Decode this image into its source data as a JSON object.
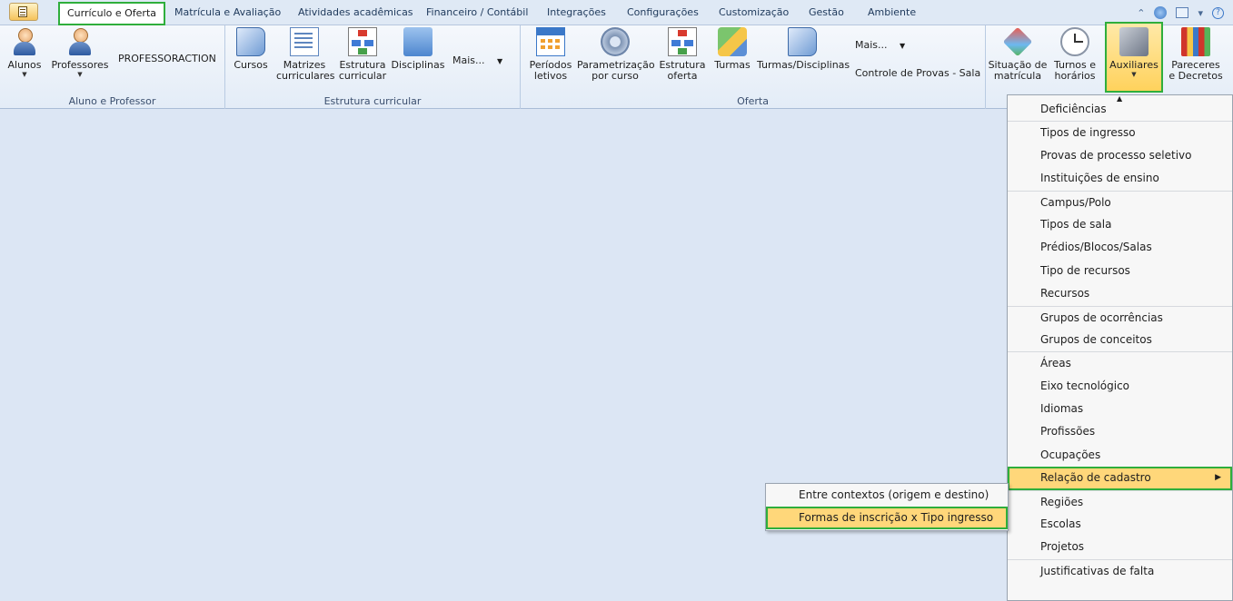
{
  "tabs": [
    "Currículo e Oferta",
    "Matrícula e Avaliação",
    "Atividades acadêmicas",
    "Financeiro / Contábil",
    "Integrações",
    "Configurações",
    "Customização",
    "Gestão",
    "Ambiente"
  ],
  "active_tab": "Currículo e Oferta",
  "ribbon": {
    "group_aluno": {
      "label": "Aluno e Professor",
      "alunos": "Alunos",
      "professores": "Professores",
      "professoraction": "PROFESSORACTION"
    },
    "group_estrutura": {
      "label": "Estrutura curricular",
      "cursos": "Cursos",
      "matrizes": "Matrizes\ncurriculares",
      "estrutura_curricular": "Estrutura\ncurricular",
      "disciplinas": "Disciplinas",
      "mais": "Mais..."
    },
    "group_oferta": {
      "label": "Oferta",
      "periodos": "Períodos\nletivos",
      "parametrizacao": "Parametrização\npor curso",
      "estrutura_oferta": "Estrutura\noferta",
      "turmas": "Turmas",
      "turmas_disciplinas": "Turmas/Disciplinas",
      "mais": "Mais...",
      "controle_provas": "Controle de Provas - Sala"
    },
    "group_misc": {
      "situacao": "Situação de\nmatrícula",
      "turnos": "Turnos e\nhorários",
      "auxiliares": "Auxiliares",
      "pareceres": "Pareceres\ne Decretos"
    }
  },
  "auxiliares_menu": {
    "items": [
      {
        "label": "Deficiências",
        "sep": false
      },
      {
        "label": "Tipos de ingresso",
        "sep": true
      },
      {
        "label": "Provas de processo seletivo",
        "sep": false
      },
      {
        "label": "Instituições de ensino",
        "sep": false
      },
      {
        "label": "Campus/Polo",
        "sep": true
      },
      {
        "label": "Tipos de sala",
        "sep": false
      },
      {
        "label": "Prédios/Blocos/Salas",
        "sep": false
      },
      {
        "label": "Tipo de recursos",
        "sep": false
      },
      {
        "label": "Recursos",
        "sep": false
      },
      {
        "label": "Grupos de ocorrências",
        "sep": true
      },
      {
        "label": "Grupos de conceitos",
        "sep": false
      },
      {
        "label": "Áreas",
        "sep": true
      },
      {
        "label": "Eixo tecnológico",
        "sep": false
      },
      {
        "label": "Idiomas",
        "sep": false
      },
      {
        "label": "Profissões",
        "sep": false
      },
      {
        "label": "Ocupações",
        "sep": false
      },
      {
        "label": "Relação de cadastro",
        "sep": true,
        "highlighted": true,
        "submenu": true
      },
      {
        "label": "Regiões",
        "sep": true
      },
      {
        "label": "Escolas",
        "sep": false
      },
      {
        "label": "Projetos",
        "sep": false
      },
      {
        "label": "Justificativas de falta",
        "sep": true
      }
    ]
  },
  "relacao_submenu": {
    "items": [
      {
        "label": "Entre contextos (origem e destino)",
        "highlighted": false
      },
      {
        "label": "Formas de inscrição x Tipo ingresso",
        "highlighted": true
      }
    ]
  },
  "colors": {
    "highlight_border": "#2fae3c",
    "menu_hover": "#ffd77a",
    "workspace": "#dce6f4"
  }
}
